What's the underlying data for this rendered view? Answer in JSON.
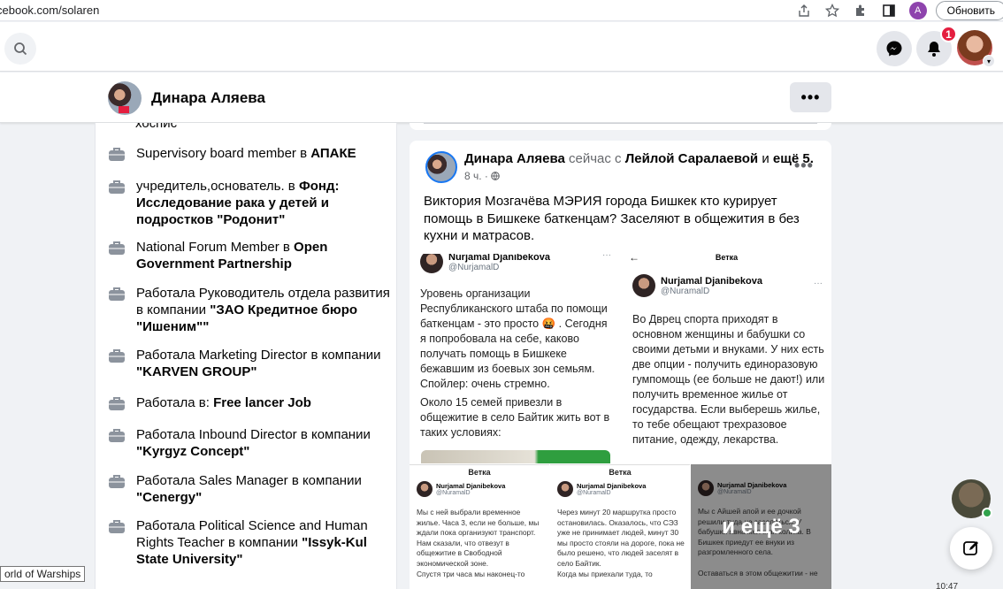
{
  "browser": {
    "url": "cebook.com/solaren",
    "profile_letter": "A",
    "update_label": "Обновить"
  },
  "topbar": {
    "notif_count": "1"
  },
  "profile": {
    "name": "Динара Аляева",
    "more": "•••"
  },
  "intro": {
    "cut_top": "хоспис",
    "items": [
      {
        "pre": "Supervisory board member в ",
        "bold": "АПАКЕ"
      },
      {
        "pre": "учредитель,основатель. в ",
        "bold": "Фонд: Исследование рака у детей и подростков \"Родонит\""
      },
      {
        "pre": "National Forum Member в ",
        "bold": "Open Government Partnership"
      },
      {
        "pre": "Работала Руководитель отдела развития в компании ",
        "bold": "\"ЗАО Кредитное бюро \"Ишеним\"\""
      },
      {
        "pre": "Работала Marketing Director в компании ",
        "bold": "\"KARVEN GROUP\""
      },
      {
        "pre": "Работала в: ",
        "bold": "Free lancer Job"
      },
      {
        "pre": "Работала Inbound Director в компании ",
        "bold": "\"Kyrgyz Concept\""
      },
      {
        "pre": "Работала Sales Manager в компании ",
        "bold": "\"Cenergy\""
      },
      {
        "pre": "Работала Political Science and Human Rights Teacher в компании ",
        "bold": "\"Issyk-Kul State University\""
      }
    ]
  },
  "post": {
    "author": "Динара Аляева",
    "status": " сейчас с ",
    "with": "Лейлой Саралаевой",
    "and": " и ",
    "others": "ещё 5.",
    "time": "8 ч. · ",
    "dots": "•••",
    "text": "Виктория Мозгачёва МЭРИЯ города Бишкек кто курирует помощь в Бишкеке баткенцам? Заселяют в общежития в без кухни и матрасов.",
    "img1": {
      "name": "Nurjamal Djanibekova",
      "handle": "@NurjamalD",
      "text1": "Уровень организации Республиканского штаба по помощи баткенцам - это просто 🤬 . Сегодня я попробовала на себе, каково получать помощь в Бишкеке бежавшим из боевых зон семьям. Спойлер: очень стремно.",
      "text2": "Около 15 семей привезли в общежитие в село Байтик жить вот в таких условиях:"
    },
    "img2": {
      "top": "Ветка",
      "name": "Nurjamal Djanibekova",
      "handle": "@NuramalD",
      "text": "Во Дврец спорта приходят в основном женщины и бабушки со своими детьми и внуками. У них есть две опции - получить единоразовую гумпомощь (ее больше не дают!) или получить временное жилье от государства. Если выберешь жилье, то тебе обещают трехразовое питание, одежду, лекарства."
    },
    "img3": {
      "top": "Ветка",
      "name": "Nurjamal Djanibekova",
      "handle": "@NuramalD",
      "text": "Мы с ней выбрали временное жилье. Часа 3, если не больше, мы ждали пока организуют транспорт. Нам сказали, что отвезут в общежитие в Свободной экономической зоне.",
      "text2": "Спустя три часа мы наконец-то"
    },
    "img4": {
      "top": "Ветка",
      "name": "Nurjamal Djanibekova",
      "handle": "@NuramalD",
      "text": "Через минут 20 маршрутка просто остановилась. Оказалось, что СЭЗ уже не принимает людей, минут 30 мы просто стояли на дороге, пока не было решено, что людей заселят в село Байтик.",
      "text2": "Когда мы приехали туда, то"
    },
    "img5": {
      "name": "Nurjamal Djanibekova",
      "handle": "@NuramalD",
      "text": "Мы с Айшей апой и ее дочкой решили туда не заселяться. У бабушки явна желчная колика. В Бишкек приедут ее внуки из разгромленного села.",
      "text2": "Оставаться в этом общежитии - не"
    },
    "more_overlay": "и ещё 3"
  },
  "tooltip": "orld of Warships",
  "clock": "10:47"
}
